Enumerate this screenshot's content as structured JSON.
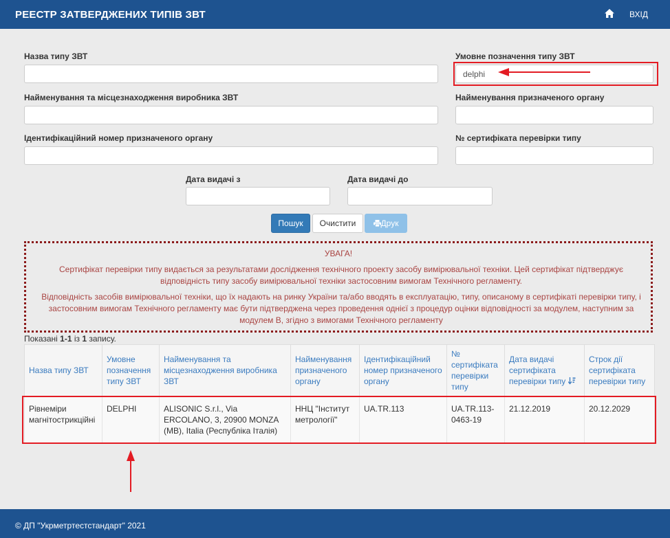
{
  "header": {
    "title": "РЕЕСТР ЗАТВЕРДЖЕНИХ ТИПІВ ЗВТ",
    "login_label": "ВХІД",
    "home_icon": "home-icon"
  },
  "form": {
    "type_name_label": "Назва типу ЗВТ",
    "type_name_value": "",
    "designation_label": "Умовне позначення типу ЗВТ",
    "designation_value": "delphi",
    "manufacturer_label": "Найменування та місцезнаходження виробника ЗВТ",
    "manufacturer_value": "",
    "notified_body_label": "Найменування призначеного органу",
    "notified_body_value": "",
    "body_id_label": "Ідентифікаційний номер призначеного органу",
    "body_id_value": "",
    "cert_no_label": "№ сертифіката перевірки типу",
    "cert_no_value": "",
    "date_from_label": "Дата видачі з",
    "date_from_value": "",
    "date_to_label": "Дата видачі до",
    "date_to_value": ""
  },
  "buttons": {
    "search": "Пошук",
    "clear": "Очистити",
    "print": "Друк",
    "print_icon": "printer-icon"
  },
  "warning": {
    "title": "УВАГА!",
    "p1": "Сертифікат перевірки типу видається за результатами дослідження технічного проекту засобу вимірювальної техніки. Цей сертифікат підтверджує відповідність типу засобу вимірювальної техніки застосовним вимогам Технічного регламенту.",
    "p2": "Відповідність засобів вимірювальної техніки, що їх надають на ринку України та/або вводять в експлуатацію, типу, описаному в сертифікаті перевірки типу, і застосовним вимогам Технічного регламенту має бути підтверджена через проведення однієї з процедур оцінки відповідності за модулем, наступним за модулем B, згідно з вимогами Технічного регламенту"
  },
  "results": {
    "prefix": "Показані ",
    "range": "1-1",
    "middle": " із ",
    "total": "1",
    "suffix": " запису."
  },
  "table": {
    "headers": [
      "Назва типу ЗВТ",
      "Умовне позначення типу ЗВТ",
      "Найменування та місцезнаходження виробника ЗВТ",
      "Найменування призначеного органу",
      "Ідентифікаційний номер призначеного органу",
      "№ сертифіката перевірки типу",
      "Дата видачі сертифіката перевірки типу",
      "Строк дії сертифіката перевірки типу"
    ],
    "sort_icon": "sort-desc-icon",
    "rows": [
      [
        "Рівнеміри магнітострикційні",
        "DELPHI",
        "ALISONIC S.r.l., Via ERCOLANO, 3, 20900 MONZA (MB), Italia (Республіка Італія)",
        "ННЦ \"Інститут метрології\"",
        "UA.TR.113",
        "UA.TR.113-0463-19",
        "21.12.2019",
        "20.12.2029"
      ]
    ]
  },
  "annotation_color": "#e31b23",
  "brand_color": "#1e5390",
  "footer": {
    "text": "© ДП \"Укрметртестстандарт\" 2021"
  }
}
